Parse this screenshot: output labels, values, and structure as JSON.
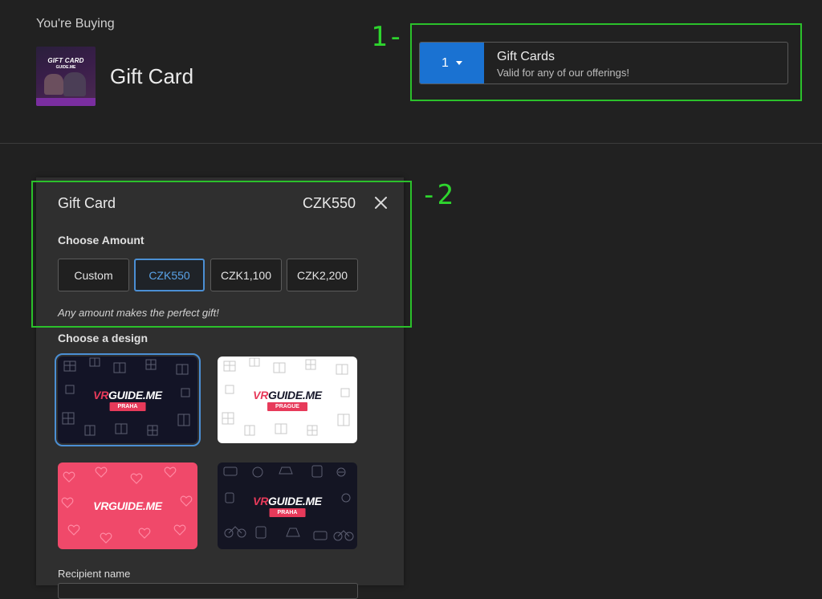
{
  "header": {
    "youre_buying": "You're Buying",
    "product_title": "Gift Card",
    "thumb": {
      "line1": "GIFT CARD",
      "line2": "GUIDE.ME"
    }
  },
  "selector": {
    "quantity": "1",
    "ticket_name": "Gift Cards",
    "ticket_desc": "Valid for any of our offerings!"
  },
  "annotations": {
    "label_1": "1-",
    "label_2": "-2"
  },
  "panel": {
    "title": "Gift Card",
    "amount": "CZK550",
    "choose_amount": "Choose Amount",
    "amounts": [
      "Custom",
      "CZK550",
      "CZK1,100",
      "CZK2,200"
    ],
    "selected_amount": "CZK550",
    "hint": "Any amount makes the perfect gift!",
    "choose_design": "Choose a design",
    "designs": [
      {
        "logo_a": "VR",
        "logo_b": "GUIDE.ME",
        "tag": "PRAHA"
      },
      {
        "logo_a": "VR",
        "logo_b": "GUIDE.ME",
        "tag": "PRAGUE"
      },
      {
        "logo_a": "VR",
        "logo_b": "GUIDE.ME",
        "tag": ""
      },
      {
        "logo_a": "VR",
        "logo_b": "GUIDE.ME",
        "tag": "PRAHA"
      }
    ],
    "recipient_label": "Recipient name"
  },
  "colors": {
    "accent_blue": "#1a72d2",
    "selected_outline": "#4b8fd4",
    "brand_pink": "#e73a5a",
    "annotation_green": "#2bc12b"
  }
}
